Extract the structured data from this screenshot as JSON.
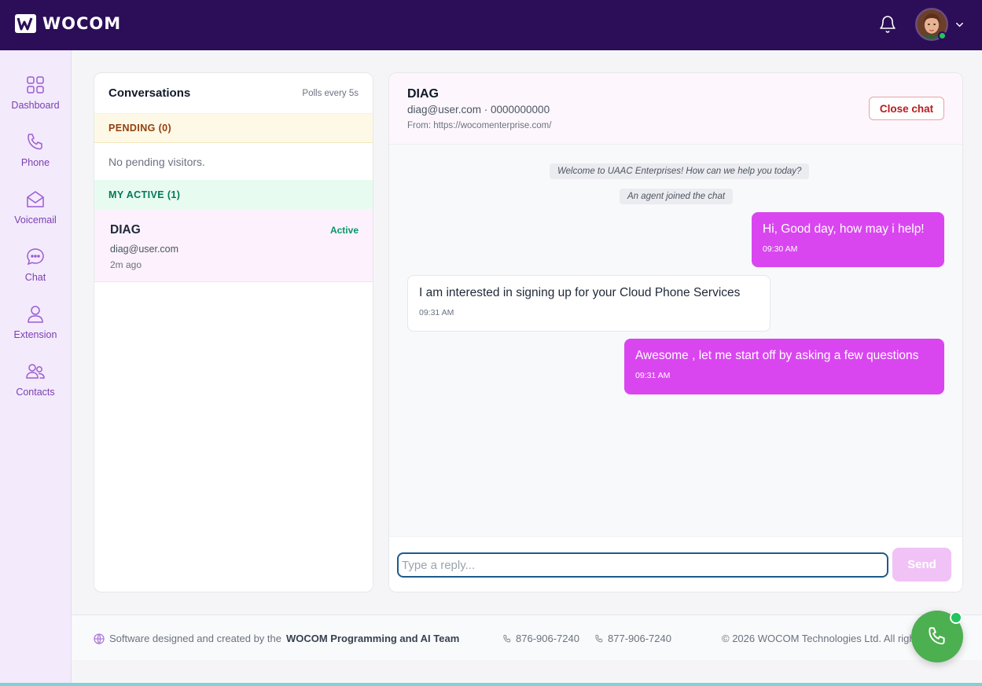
{
  "app": {
    "brand": "WOCOM",
    "colors": {
      "topbar": "#2b0e57",
      "accent": "#d946ef",
      "sidebar": "#f3eafc",
      "online": "#22c55e"
    }
  },
  "header": {
    "icons": [
      "bell-icon",
      "avatar",
      "chevron-down-icon"
    ]
  },
  "sidebar": {
    "items": [
      {
        "label": "Dashboard",
        "icon": "grid-icon"
      },
      {
        "label": "Phone",
        "icon": "phone-icon"
      },
      {
        "label": "Voicemail",
        "icon": "envelope-icon"
      },
      {
        "label": "Chat",
        "icon": "chat-bubble-icon"
      },
      {
        "label": "Extension",
        "icon": "user-icon"
      },
      {
        "label": "Contacts",
        "icon": "users-icon"
      }
    ]
  },
  "conversations": {
    "title": "Conversations",
    "poll_note": "Polls every 5s",
    "pending_header": "PENDING (0)",
    "pending_empty": "No pending visitors.",
    "active_header": "MY ACTIVE (1)",
    "active_items": [
      {
        "name": "DIAG",
        "status": "Active",
        "email": "diag@user.com",
        "time": "2m ago"
      }
    ]
  },
  "chat": {
    "name": "DIAG",
    "contact": "diag@user.com · 0000000000",
    "from": "From: https://wocomenterprise.com/",
    "close_label": "Close chat",
    "system_messages": [
      "Welcome to UAAC Enterprises! How can we help you today?",
      "An agent joined the chat"
    ],
    "messages": [
      {
        "direction": "out",
        "text": "Hi, Good day, how may i help!",
        "time": "09:30 AM"
      },
      {
        "direction": "in",
        "text": "I am interested in signing up for your Cloud  Phone Services",
        "time": "09:31 AM"
      },
      {
        "direction": "out",
        "text": "Awesome , let me start off by asking a few questions",
        "time": "09:31 AM"
      }
    ],
    "reply_placeholder": "Type a reply...",
    "reply_value": "",
    "send_label": "Send"
  },
  "footer": {
    "credit_prefix": "Software designed and created by the",
    "credit_team": "WOCOM Programming and AI Team",
    "phone_1": "876-906-7240",
    "phone_2": "877-906-7240",
    "copyright": "© 2026 WOCOM Technologies Ltd. All righ"
  }
}
